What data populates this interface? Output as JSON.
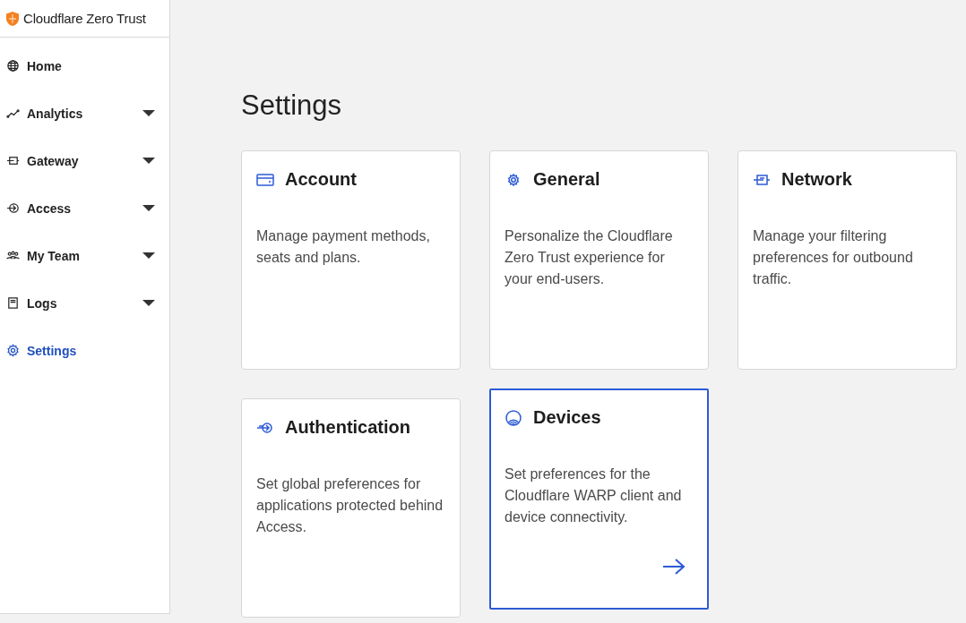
{
  "brand": {
    "name": "Cloudflare Zero Trust"
  },
  "sidebar": {
    "items": [
      {
        "label": "Home",
        "expandable": false,
        "selected": false
      },
      {
        "label": "Analytics",
        "expandable": true,
        "selected": false
      },
      {
        "label": "Gateway",
        "expandable": true,
        "selected": false
      },
      {
        "label": "Access",
        "expandable": true,
        "selected": false
      },
      {
        "label": "My Team",
        "expandable": true,
        "selected": false
      },
      {
        "label": "Logs",
        "expandable": true,
        "selected": false
      },
      {
        "label": "Settings",
        "expandable": false,
        "selected": true
      }
    ]
  },
  "page": {
    "title": "Settings"
  },
  "cards": [
    {
      "title": "Account",
      "description": "Manage payment methods, seats and plans.",
      "hovered": false
    },
    {
      "title": "General",
      "description": "Personalize the Cloudflare Zero Trust experience for your end-users.",
      "hovered": false
    },
    {
      "title": "Network",
      "description": "Manage your filtering preferences for outbound traffic.",
      "hovered": false
    },
    {
      "title": "Authentication",
      "description": "Set global preferences for applications protected behind Access.",
      "hovered": false
    },
    {
      "title": "Devices",
      "description": "Set preferences for the Cloudflare WARP client and device connectivity.",
      "hovered": true
    }
  ]
}
